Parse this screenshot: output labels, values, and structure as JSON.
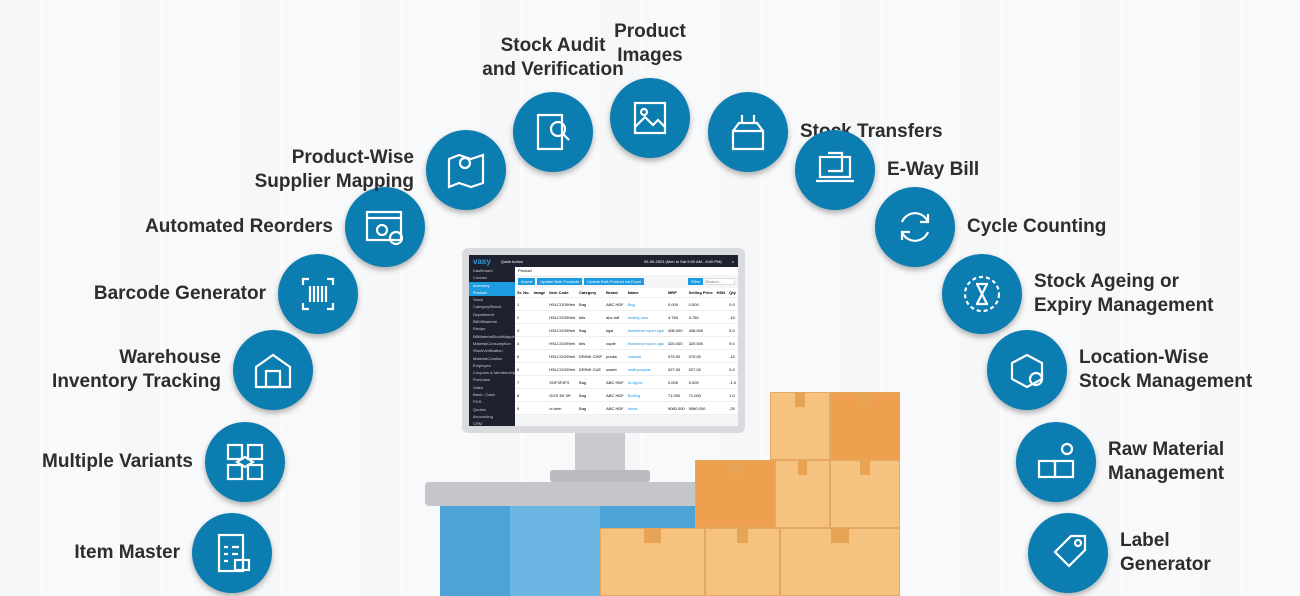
{
  "features": [
    {
      "label": "Item Master",
      "icon": "checklist-boxes-icon"
    },
    {
      "label": "Multiple Variants",
      "icon": "variant-boxes-icon"
    },
    {
      "label": "Warehouse\nInventory Tracking",
      "icon": "warehouse-icon"
    },
    {
      "label": "Barcode Generator",
      "icon": "barcode-icon"
    },
    {
      "label": "Automated Reorders",
      "icon": "gear-window-icon"
    },
    {
      "label": "Product-Wise\nSupplier Mapping",
      "icon": "map-pin-icon"
    },
    {
      "label": "Stock Audit\nand Verification",
      "icon": "audit-magnifier-icon"
    },
    {
      "label": "Product\nImages",
      "icon": "image-icon"
    },
    {
      "label": "Stock Transfers",
      "icon": "box-transfer-icon"
    },
    {
      "label": "E-Way Bill",
      "icon": "laptop-bill-icon"
    },
    {
      "label": "Cycle Counting",
      "icon": "cycle-arrows-icon"
    },
    {
      "label": "Stock Ageing or\nExpiry Management",
      "icon": "hourglass-icon"
    },
    {
      "label": "Location-Wise\nStock Management",
      "icon": "box-location-icon"
    },
    {
      "label": "Raw Material\nManagement",
      "icon": "raw-material-icon"
    },
    {
      "label": "Label\nGenerator",
      "icon": "tag-icon"
    }
  ],
  "app": {
    "logo": "vasy",
    "quick_action": "Quick Action",
    "session": "09-05-2023 (Mon to Sat 9:00 AM - 8:00 PM)",
    "sidebar": [
      "Dashboard",
      "Contact",
      "Inventory",
      "Product",
      "Stock",
      "Category/Brand",
      "Department",
      "BillOfMaterial",
      "Recipe",
      "BillMaterialStockMapping",
      "MaterialConsumption",
      "StockVerification",
      "MaterialCreation",
      "Employee",
      "Coupons & Membership/Offer",
      "Purchase",
      "Sales",
      "Bank / Cash",
      "POS",
      "Quotes",
      "Accounting",
      "CRM"
    ],
    "breadcrumb": "Product",
    "buttons": [
      "Import",
      "Update Bulk Products",
      "Update Bulk Product via Excel",
      "Filter"
    ],
    "search_placeholder": "Search...",
    "columns": [
      "Sr. No.",
      "Image",
      "Item Code",
      "Category",
      "Brand",
      "Name",
      "MRP",
      "Selling Price",
      "HSN",
      "Qty"
    ],
    "rows": [
      [
        "1",
        "",
        "HSLCOO99eh",
        "Bag",
        "ABC HDF",
        "Bag",
        "0.000",
        "0.000",
        "",
        "0.0"
      ],
      [
        "2",
        "",
        "HSLCOO99eh",
        "bits",
        "abc hdf",
        "testing new",
        "4.750",
        "4.750",
        "",
        "-10"
      ],
      [
        "3",
        "",
        "HSLCOO99eh",
        "Bag",
        "kgsi",
        "bluediesel sport kgsi",
        "408.000",
        "408.000",
        "",
        "5.0"
      ],
      [
        "4",
        "",
        "HSLCOO99eh",
        "bits",
        "cuple",
        "bluediesel sport kgsi",
        "320.000",
        "320.000",
        "",
        "9.0"
      ],
      [
        "5",
        "",
        "HSLCOO99eh",
        "DRINK CHIP",
        "punks",
        "colonial",
        "079.00",
        "079.00",
        "",
        "-10"
      ],
      [
        "6",
        "",
        "HSLCOO99eh",
        "DRINK CUE",
        "sweet",
        "seafrywaysis",
        "027.00",
        "027.00",
        "",
        "0.0"
      ],
      [
        "7",
        "",
        "SGF3F3F3",
        "Bag",
        "ABC HDF",
        "ht-Apple",
        "0.000",
        "0.000",
        "",
        "-1.0"
      ],
      [
        "8",
        "",
        "GGS 3H 3H",
        "Bag",
        "ABC HDF",
        "Botting",
        "71.000",
        "71.000",
        "",
        "1.0"
      ],
      [
        "9",
        "",
        "ut ahm",
        "Bag",
        "ABC HDF",
        "dress",
        "9080.000",
        "9080.000",
        "",
        "-20"
      ]
    ]
  },
  "colors": {
    "circle": "#0c7db0",
    "app_accent": "#1d9be0",
    "sidebar": "#1d2130"
  }
}
